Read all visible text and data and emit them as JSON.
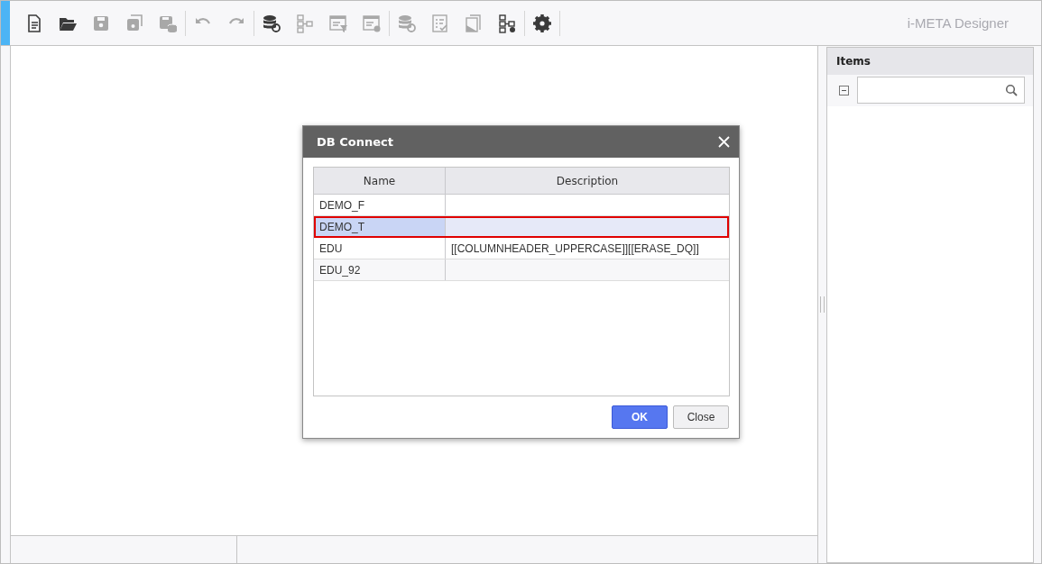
{
  "toolbar": {
    "groups": [
      [
        {
          "kind": "new-file",
          "disabled": false
        },
        {
          "kind": "open-folder",
          "disabled": false
        },
        {
          "kind": "save",
          "disabled": true
        },
        {
          "kind": "save-all",
          "disabled": true
        },
        {
          "kind": "save-db",
          "disabled": true
        }
      ],
      [
        {
          "kind": "undo",
          "disabled": true
        },
        {
          "kind": "redo",
          "disabled": true
        }
      ],
      [
        {
          "kind": "db-link",
          "disabled": false
        },
        {
          "kind": "tree",
          "disabled": true
        },
        {
          "kind": "table-filter",
          "disabled": true
        },
        {
          "kind": "window-gear",
          "disabled": true
        }
      ],
      [
        {
          "kind": "db-search",
          "disabled": true
        },
        {
          "kind": "checklist",
          "disabled": true
        },
        {
          "kind": "document",
          "disabled": true
        },
        {
          "kind": "tree-gear",
          "disabled": false
        }
      ],
      [
        {
          "kind": "gear",
          "disabled": false
        }
      ]
    ],
    "app_title": "i-META Designer"
  },
  "items_panel": {
    "title": "Items",
    "search": {
      "kind": "search"
    }
  },
  "dialog": {
    "title": "DB Connect",
    "columns": [
      "Name",
      "Description"
    ],
    "rows": [
      {
        "name": "DEMO_F",
        "selected": false
      },
      {
        "name": "DEMO_T",
        "selected": true
      },
      {
        "name": "EDU",
        "description": "[[COLUMNHEADER_UPPERCASE]][[ERASE_DQ]]",
        "selected": false
      },
      {
        "name": "EDU_92",
        "selected": false
      }
    ],
    "buttons": [
      {
        "label": "OK",
        "kind": "primary"
      },
      {
        "label": "Close",
        "kind": "secondary"
      }
    ]
  }
}
